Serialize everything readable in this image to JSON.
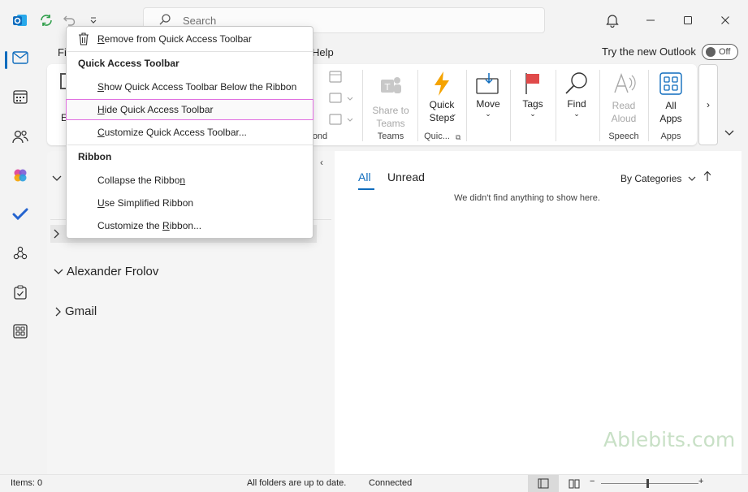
{
  "search": {
    "placeholder": "Search"
  },
  "tabs": {
    "file": "Fi",
    "help": "Help"
  },
  "try_new_outlook": {
    "label": "Try the new Outlook",
    "toggle": "Off"
  },
  "ribbon": {
    "buttons": {
      "share_to_teams": "Share to\nTeams",
      "quick_steps": "Quick\nSteps",
      "move": "Move",
      "tags": "Tags",
      "find": "Find",
      "read_aloud": "Read\nAloud",
      "all_apps": "All\nApps"
    },
    "groups": {
      "respond": "ond",
      "teams": "Teams",
      "quick_steps": "Quic...",
      "speech": "Speech",
      "apps": "Apps"
    },
    "more": "›",
    "left_partial": "E"
  },
  "folders": [
    {
      "name": "Alexander Frolov"
    },
    {
      "name": "Gmail"
    }
  ],
  "message_list": {
    "tab_all": "All",
    "tab_unread": "Unread",
    "sort": "By Categories",
    "empty": "We didn't find anything to show here."
  },
  "watermark": "Ablebits.com",
  "status": {
    "items": "Items: 0",
    "sync": "All folders are up to date.",
    "connection": "Connected"
  },
  "dropdown": {
    "remove": {
      "pre": "",
      "key": "R",
      "post": "emove from Quick Access Toolbar"
    },
    "qat_heading": "Quick Access Toolbar",
    "show_below": {
      "pre": "",
      "key": "S",
      "post": "how Quick Access Toolbar Below the Ribbon"
    },
    "hide": {
      "pre": "",
      "key": "H",
      "post": "ide Quick Access Toolbar"
    },
    "customize_qat": {
      "pre": "",
      "key": "C",
      "post": "ustomize Quick Access Toolbar..."
    },
    "ribbon_heading": "Ribbon",
    "collapse": {
      "pre": "Collapse the Ribbo",
      "key": "n",
      "post": ""
    },
    "simplified": {
      "pre": "",
      "key": "U",
      "post": "se Simplified Ribbon"
    },
    "customize_ribbon": {
      "pre": "Customize the ",
      "key": "R",
      "post": "ibbon..."
    }
  },
  "colors": {
    "accent": "#0f6cbd",
    "highlight_border": "#e070e0",
    "flag": "#e04a4a",
    "lightning": "#f5a300"
  }
}
